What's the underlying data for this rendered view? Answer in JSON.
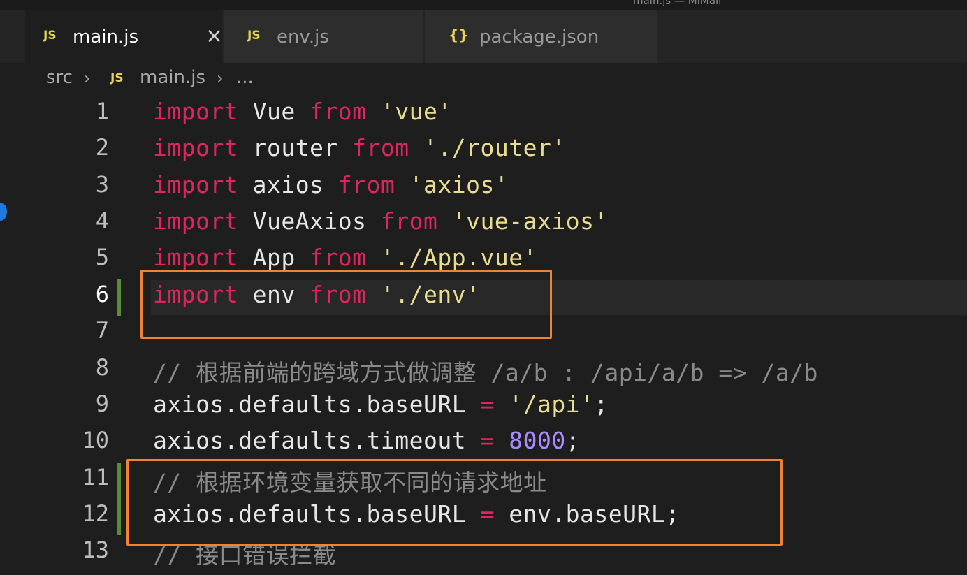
{
  "window": {
    "title": "main.js — MiMall"
  },
  "tabs": [
    {
      "icon": "JS",
      "label": "main.js",
      "active": true,
      "close": "×"
    },
    {
      "icon": "JS",
      "label": "env.js",
      "active": false
    },
    {
      "icon": "{}",
      "label": "package.json",
      "active": false
    }
  ],
  "breadcrumb": {
    "folder": "src",
    "file_icon": "JS",
    "file": "main.js",
    "more": "..."
  },
  "editor": {
    "current_line": 6,
    "lines": [
      {
        "n": "1"
      },
      {
        "n": "2"
      },
      {
        "n": "3"
      },
      {
        "n": "4"
      },
      {
        "n": "5"
      },
      {
        "n": "6"
      },
      {
        "n": "7"
      },
      {
        "n": "8"
      },
      {
        "n": "9"
      },
      {
        "n": "10"
      },
      {
        "n": "11"
      },
      {
        "n": "12"
      },
      {
        "n": "13"
      }
    ],
    "code": {
      "l1": {
        "kw": "import",
        "id": " Vue ",
        "kw2": "from",
        "str": " 'vue'"
      },
      "l2": {
        "kw": "import",
        "id": " router ",
        "kw2": "from",
        "str": " './router'"
      },
      "l3": {
        "kw": "import",
        "id": " axios ",
        "kw2": "from",
        "str": " 'axios'"
      },
      "l4": {
        "kw": "import",
        "id": " VueAxios ",
        "kw2": "from",
        "str": " 'vue-axios'"
      },
      "l5": {
        "kw": "import",
        "id": " App ",
        "kw2": "from",
        "str": " './App.vue'"
      },
      "l6": {
        "kw": "import",
        "id": " env ",
        "kw2": "from",
        "str": " './env'"
      },
      "l8": {
        "comment": "// 根据前端的跨域方式做调整 /a/b : /api/a/b => /a/b"
      },
      "l9": {
        "lhs": "axios.defaults.baseURL ",
        "op": "=",
        "str": " '/api'",
        "end": ";"
      },
      "l10": {
        "lhs": "axios.defaults.timeout ",
        "op": "=",
        "num": " 8000",
        "end": ";"
      },
      "l11": {
        "comment": "// 根据环境变量获取不同的请求地址"
      },
      "l12": {
        "lhs": "axios.defaults.baseURL ",
        "op": "=",
        "rhs": " env.baseURL;"
      },
      "l13": {
        "comment": "// 接口错误拦截"
      }
    }
  },
  "colors": {
    "keyword": "#e0245e",
    "string": "#e9dc91",
    "comment": "#8a8a8a",
    "number": "#a68cff",
    "highlight_box": "#f08232",
    "gutter_modified": "#588c36"
  }
}
